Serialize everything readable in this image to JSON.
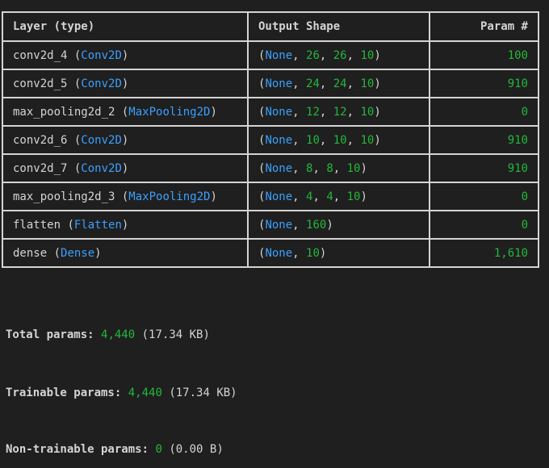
{
  "headers": {
    "layer": "Layer (type)",
    "shape": "Output Shape",
    "param": "Param #"
  },
  "rows": [
    {
      "name": "conv2d_4",
      "type": "Conv2D",
      "dims": [
        "26",
        "26",
        "10"
      ],
      "params": "100"
    },
    {
      "name": "conv2d_5",
      "type": "Conv2D",
      "dims": [
        "24",
        "24",
        "10"
      ],
      "params": "910"
    },
    {
      "name": "max_pooling2d_2",
      "type": "MaxPooling2D",
      "dims": [
        "12",
        "12",
        "10"
      ],
      "params": "0"
    },
    {
      "name": "conv2d_6",
      "type": "Conv2D",
      "dims": [
        "10",
        "10",
        "10"
      ],
      "params": "910"
    },
    {
      "name": "conv2d_7",
      "type": "Conv2D",
      "dims": [
        "8",
        "8",
        "10"
      ],
      "params": "910"
    },
    {
      "name": "max_pooling2d_3",
      "type": "MaxPooling2D",
      "dims": [
        "4",
        "4",
        "10"
      ],
      "params": "0"
    },
    {
      "name": "flatten",
      "type": "Flatten",
      "dims": [
        "160"
      ],
      "params": "0"
    },
    {
      "name": "dense",
      "type": "Dense",
      "dims": [
        "10"
      ],
      "params": "1,610"
    }
  ],
  "none_keyword": "None",
  "totals": {
    "total": {
      "label": "Total params:",
      "value": "4,440",
      "size": "(17.34 KB)"
    },
    "trainable": {
      "label": "Trainable params:",
      "value": "4,440",
      "size": "(17.34 KB)"
    },
    "non_trainable": {
      "label": "Non-trainable params:",
      "value": "0",
      "size": "(0.00 B)"
    }
  },
  "colors": {
    "background": "#1f1f1f",
    "text": "#d4d4d4",
    "keyword_blue": "#3aa0ff",
    "number_green": "#22b83a"
  }
}
